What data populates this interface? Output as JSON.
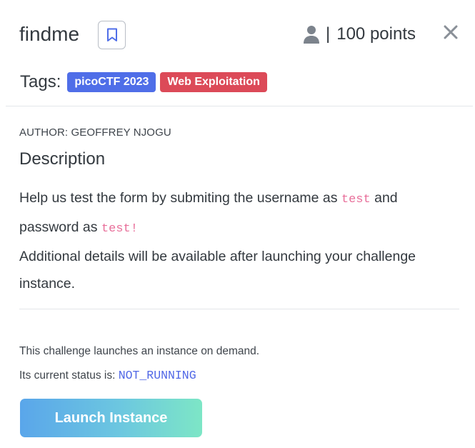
{
  "challenge": {
    "title": "findme",
    "points_separator": "|",
    "points_label": "100 points"
  },
  "tags": {
    "label": "Tags:",
    "items": [
      {
        "label": "picoCTF 2023",
        "color": "#4f6ee8"
      },
      {
        "label": "Web Exploitation",
        "color": "#dc4a58"
      }
    ]
  },
  "details": {
    "author": "AUTHOR: GEOFFREY NJOGU",
    "heading": "Description",
    "line1_prefix": "Help us test the form by submiting the username as ",
    "username_code": "test",
    "line1_suffix": " and",
    "line2_prefix": "password as ",
    "password_code": "test!",
    "line3": "Additional details will be available after launching your challenge instance."
  },
  "instance": {
    "note": "This challenge launches an instance on demand.",
    "status_prefix": "Its current status is: ",
    "status_value": "NOT_RUNNING",
    "launch_label": "Launch Instance"
  },
  "icons": {
    "bookmark": "bookmark-icon",
    "user": "user-icon",
    "close": "close-icon"
  },
  "colors": {
    "accent": "#5067e6",
    "code": "#e86f9a",
    "tag_blue": "#4f6ee8",
    "tag_red": "#dc4a58"
  }
}
